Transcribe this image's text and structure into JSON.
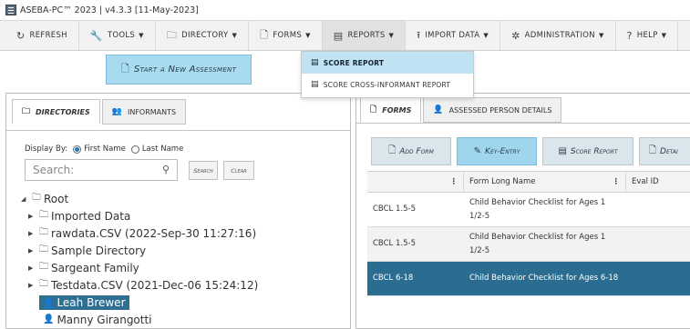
{
  "titlebar": {
    "text": "ASEBA-PC™ 2023 | v4.3.3 [11-May-2023]"
  },
  "menu": [
    {
      "label": "Refresh",
      "icon": "refresh-icon",
      "glyph": "↻"
    },
    {
      "label": "Tools",
      "icon": "wrench-icon",
      "glyph": "🔧"
    },
    {
      "label": "Directory",
      "icon": "folder-icon",
      "glyph": "🗀"
    },
    {
      "label": "Forms",
      "icon": "document-icon",
      "glyph": "🗋"
    },
    {
      "label": "Reports",
      "icon": "report-icon",
      "glyph": "▤"
    },
    {
      "label": "Import Data",
      "icon": "upload-icon",
      "glyph": "⭱"
    },
    {
      "label": "Administration",
      "icon": "gear-icon",
      "glyph": "✲"
    },
    {
      "label": "Help",
      "icon": "help-icon",
      "glyph": "?"
    }
  ],
  "reports_dropdown": [
    {
      "label": "Score Report"
    },
    {
      "label": "Score Cross-Informant Report"
    }
  ],
  "start_button": {
    "label": "Start a New Assessment"
  },
  "left_tabs": [
    {
      "label": "Directories"
    },
    {
      "label": "Informants"
    }
  ],
  "display_by": {
    "label": "Display By:",
    "options": [
      "First Name",
      "Last Name"
    ],
    "selected": "First Name"
  },
  "search": {
    "placeholder": "Search:",
    "search_label": "Search",
    "clear_label": "Clear"
  },
  "tree": {
    "root": "Root",
    "items": [
      "Imported Data",
      "rawdata.CSV (2022-Sep-30 11:27:16)",
      "Sample Directory",
      "Sargeant Family",
      "Testdata.CSV (2021-Dec-06 15:24:12)"
    ],
    "people": [
      "Leah Brewer",
      "Manny Girangotti"
    ],
    "selected": "Leah Brewer"
  },
  "right_tabs": [
    {
      "label": "Forms"
    },
    {
      "label": "Assessed Person Details"
    }
  ],
  "actions": [
    {
      "label": "Add Form"
    },
    {
      "label": "Key-Entry"
    },
    {
      "label": "Score Report"
    },
    {
      "label": "Detai"
    }
  ],
  "grid": {
    "columns": [
      "",
      "Form Long Name",
      "Eval ID"
    ],
    "rows": [
      {
        "form": "CBCL 1.5-5",
        "name": "Child Behavior Checklist for Ages 1 1/2-5",
        "eval": ""
      },
      {
        "form": "CBCL 1.5-5",
        "name": "Child Behavior Checklist for Ages 1 1/2-5",
        "eval": ""
      },
      {
        "form": "CBCL 6-18",
        "name": "Child Behavior Checklist for Ages 6-18",
        "eval": ""
      }
    ]
  },
  "colors": {
    "accent": "#a8dbef",
    "selected_row": "#2b6d90",
    "dropdown_highlight": "#bfe3f3"
  }
}
